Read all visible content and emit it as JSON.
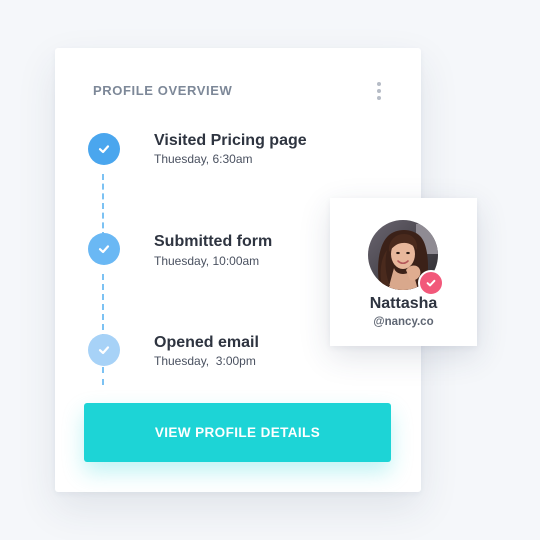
{
  "card": {
    "title": "PROFILE OVERVIEW",
    "menu_icon": "more-vertical-icon"
  },
  "timeline": [
    {
      "title": "Visited Pricing page",
      "time": "Thuesday, 6:30am",
      "icon": "check-icon",
      "color": "#4aa6ee"
    },
    {
      "title": "Submitted form",
      "time": "Thuesday, 10:00am",
      "icon": "check-icon",
      "color": "#6ab8f4"
    },
    {
      "title": "Opened email",
      "time": "Thuesday,  3:00pm",
      "icon": "check-icon",
      "color": "#a7d2f7"
    }
  ],
  "cta": {
    "label": "VIEW PROFILE DETAILS",
    "color": "#1dd4d6"
  },
  "profile": {
    "name": "Nattasha",
    "handle": "@nancy.co",
    "badge_icon": "check-icon",
    "badge_color": "#f2587a"
  }
}
